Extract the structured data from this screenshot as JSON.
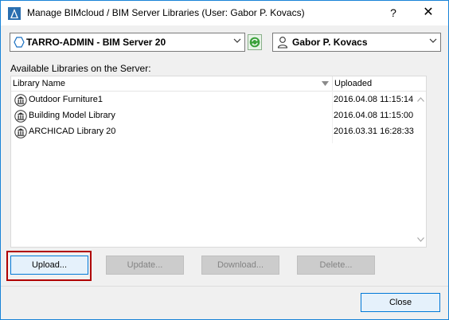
{
  "window": {
    "title": "Manage BIMcloud / BIM Server Libraries (User: Gabor P. Kovacs)",
    "help_label": "?",
    "close_label": "✕"
  },
  "server_select": {
    "value": "TARRO-ADMIN - BIM Server 20"
  },
  "user_select": {
    "value": "Gabor P. Kovacs"
  },
  "libraries": {
    "label": "Available Libraries on the Server:",
    "columns": {
      "name": "Library Name",
      "uploaded": "Uploaded"
    },
    "rows": [
      {
        "name": "Outdoor Furniture1",
        "uploaded": "2016.04.08 11:15:14"
      },
      {
        "name": "Building Model Library",
        "uploaded": "2016.04.08 11:15:00"
      },
      {
        "name": "ARCHICAD Library 20",
        "uploaded": "2016.03.31 16:28:33"
      }
    ]
  },
  "buttons": {
    "upload": "Upload...",
    "update": "Update...",
    "download": "Download...",
    "delete": "Delete...",
    "close": "Close"
  },
  "colors": {
    "accent": "#1883d7",
    "highlight": "#b00000",
    "refresh_green": "#2e9e2e"
  }
}
